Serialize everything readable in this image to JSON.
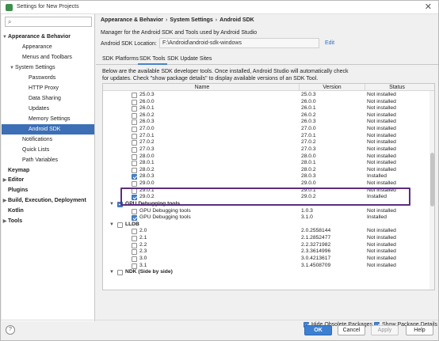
{
  "window": {
    "title": "Settings for New Projects",
    "close_glyph": "✕",
    "app_icon": "android-studio-icon"
  },
  "sidebar": {
    "search_placeholder": "",
    "search_icon": "⌕",
    "items": [
      {
        "label": "Appearance & Behavior",
        "arrow": "▼"
      },
      {
        "label": "Appearance",
        "arrow": ""
      },
      {
        "label": "Menus and Toolbars",
        "arrow": ""
      },
      {
        "label": "System Settings",
        "arrow": "▼"
      },
      {
        "label": "Passwords",
        "arrow": ""
      },
      {
        "label": "HTTP Proxy",
        "arrow": ""
      },
      {
        "label": "Data Sharing",
        "arrow": ""
      },
      {
        "label": "Updates",
        "arrow": ""
      },
      {
        "label": "Memory Settings",
        "arrow": ""
      },
      {
        "label": "Android SDK",
        "arrow": ""
      },
      {
        "label": "Notifications",
        "arrow": ""
      },
      {
        "label": "Quick Lists",
        "arrow": ""
      },
      {
        "label": "Path Variables",
        "arrow": ""
      },
      {
        "label": "Keymap",
        "arrow": ""
      },
      {
        "label": "Editor",
        "arrow": "▶"
      },
      {
        "label": "Plugins",
        "arrow": ""
      },
      {
        "label": "Build, Execution, Deployment",
        "arrow": "▶"
      },
      {
        "label": "Kotlin",
        "arrow": ""
      },
      {
        "label": "Tools",
        "arrow": "▶"
      }
    ]
  },
  "main": {
    "breadcrumb": [
      "Appearance & Behavior",
      "System Settings",
      "Android SDK"
    ],
    "breadcrumb_sep": "›",
    "subtitle": "Manager for the Android SDK and Tools used by Android Studio",
    "sdk_location_label": "Android SDK Location:",
    "sdk_location_value": "F:\\Android\\android-sdk-windows",
    "edit_link": "Edit",
    "tabs": [
      "SDK Platforms",
      "SDK Tools",
      "SDK Update Sites"
    ],
    "active_tab": "SDK Tools",
    "description_line1": "Below are the available SDK developer tools. Once installed, Android Studio will automatically check",
    "description_line2": "for updates. Check \"show package details\" to display available versions of an SDK Tool.",
    "table": {
      "headers": {
        "name": "Name",
        "version": "Version",
        "status": "Status"
      },
      "rows": [
        {
          "name": "25.0.3",
          "version": "25.0.3",
          "status": "Not installed",
          "check": "none"
        },
        {
          "name": "26.0.0",
          "version": "26.0.0",
          "status": "Not installed",
          "check": "none"
        },
        {
          "name": "26.0.1",
          "version": "26.0.1",
          "status": "Not installed",
          "check": "none"
        },
        {
          "name": "26.0.2",
          "version": "26.0.2",
          "status": "Not installed",
          "check": "none"
        },
        {
          "name": "26.0.3",
          "version": "26.0.3",
          "status": "Not installed",
          "check": "none"
        },
        {
          "name": "27.0.0",
          "version": "27.0.0",
          "status": "Not installed",
          "check": "none"
        },
        {
          "name": "27.0.1",
          "version": "27.0.1",
          "status": "Not installed",
          "check": "none"
        },
        {
          "name": "27.0.2",
          "version": "27.0.2",
          "status": "Not installed",
          "check": "none"
        },
        {
          "name": "27.0.3",
          "version": "27.0.3",
          "status": "Not installed",
          "check": "none"
        },
        {
          "name": "28.0.0",
          "version": "28.0.0",
          "status": "Not installed",
          "check": "none"
        },
        {
          "name": "28.0.1",
          "version": "28.0.1",
          "status": "Not installed",
          "check": "none"
        },
        {
          "name": "28.0.2",
          "version": "28.0.2",
          "status": "Not installed",
          "check": "none"
        },
        {
          "name": "28.0.3",
          "version": "28.0.3",
          "status": "Installed",
          "check": "checked"
        },
        {
          "name": "29.0.0",
          "version": "29.0.0",
          "status": "Not installed",
          "check": "none"
        },
        {
          "name": "29.0.1",
          "version": "29.0.1",
          "status": "Not installed",
          "check": "none"
        },
        {
          "name": "29.0.2",
          "version": "29.0.2",
          "status": "Installed",
          "check": "checked"
        },
        {
          "name": "GPU Debugging tools",
          "version": "",
          "status": "",
          "check": "partial",
          "group": true,
          "arrow": "▼"
        },
        {
          "name": "GPU Debugging tools",
          "version": "1.0.3",
          "status": "Not installed",
          "check": "none"
        },
        {
          "name": "GPU Debugging tools",
          "version": "3.1.0",
          "status": "Installed",
          "check": "checked"
        },
        {
          "name": "LLDB",
          "version": "",
          "status": "",
          "check": "none",
          "group": true,
          "arrow": "▼"
        },
        {
          "name": "2.0",
          "version": "2.0.2558144",
          "status": "Not installed",
          "check": "none"
        },
        {
          "name": "2.1",
          "version": "2.1.2852477",
          "status": "Not installed",
          "check": "none"
        },
        {
          "name": "2.2",
          "version": "2.2.3271982",
          "status": "Not installed",
          "check": "none"
        },
        {
          "name": "2.3",
          "version": "2.3.3614996",
          "status": "Not installed",
          "check": "none"
        },
        {
          "name": "3.0",
          "version": "3.0.4213617",
          "status": "Not installed",
          "check": "none"
        },
        {
          "name": "3.1",
          "version": "3.1.4508709",
          "status": "Not installed",
          "check": "none"
        },
        {
          "name": "NDK (Side by side)",
          "version": "",
          "status": "",
          "check": "none",
          "group": true,
          "arrow": "▼"
        }
      ]
    },
    "hide_obsolete_label": "Hide Obsolete Packages",
    "hide_obsolete_checked": true,
    "show_details_label": "Show Package Details",
    "show_details_checked": true
  },
  "footer": {
    "help_glyph": "?",
    "ok": "OK",
    "cancel": "Cancel",
    "apply": "Apply",
    "help": "Help"
  },
  "colors": {
    "selection": "#3c6fb5",
    "annotation_box": "#5a2e7f",
    "primary_button": "#3d7fd0"
  }
}
